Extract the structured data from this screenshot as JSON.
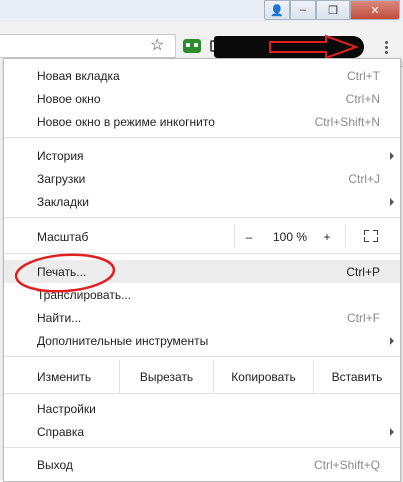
{
  "window": {
    "controls": [
      {
        "name": "user-icon",
        "glyph": "👤"
      },
      {
        "name": "minimize-icon",
        "glyph": "–"
      },
      {
        "name": "maximize-icon",
        "glyph": "❐"
      },
      {
        "name": "close-icon",
        "glyph": "✕"
      }
    ]
  },
  "toolbar": {
    "star_glyph": "☆",
    "annotation_color": "#e02020"
  },
  "menu": {
    "new_tab": {
      "label": "Новая вкладка",
      "shortcut": "Ctrl+T"
    },
    "new_window": {
      "label": "Новое окно",
      "shortcut": "Ctrl+N"
    },
    "incognito": {
      "label": "Новое окно в режиме инкогнито",
      "shortcut": "Ctrl+Shift+N"
    },
    "history": {
      "label": "История"
    },
    "downloads": {
      "label": "Загрузки",
      "shortcut": "Ctrl+J"
    },
    "bookmarks": {
      "label": "Закладки"
    },
    "zoom": {
      "label": "Масштаб",
      "minus": "–",
      "value": "100 %",
      "plus": "+"
    },
    "print": {
      "label": "Печать...",
      "shortcut": "Ctrl+P"
    },
    "cast": {
      "label": "Транслировать..."
    },
    "find": {
      "label": "Найти...",
      "shortcut": "Ctrl+F"
    },
    "more_tools": {
      "label": "Дополнительные инструменты"
    },
    "edit": {
      "label": "Изменить",
      "cut": "Вырезать",
      "copy": "Копировать",
      "paste": "Вставить"
    },
    "settings": {
      "label": "Настройки"
    },
    "help": {
      "label": "Справка"
    },
    "exit": {
      "label": "Выход",
      "shortcut": "Ctrl+Shift+Q"
    }
  }
}
